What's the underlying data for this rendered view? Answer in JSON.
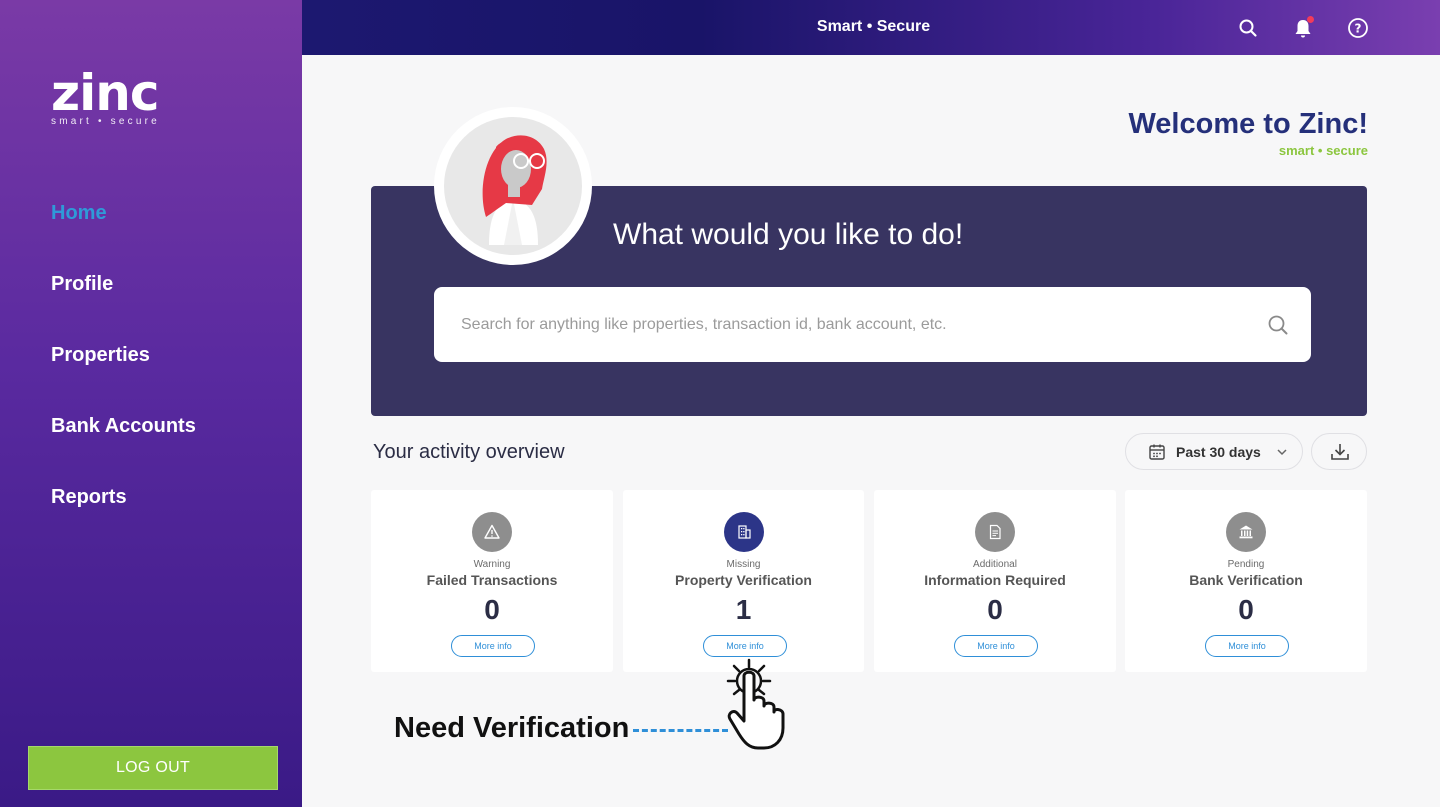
{
  "brand": {
    "logo_text": "zinc",
    "logo_tagline": "smart • secure"
  },
  "sidebar": {
    "items": [
      {
        "label": "Home",
        "active": true
      },
      {
        "label": "Profile"
      },
      {
        "label": "Properties"
      },
      {
        "label": "Bank Accounts"
      },
      {
        "label": "Reports"
      }
    ],
    "logout_label": "LOG OUT"
  },
  "topbar": {
    "title": "Smart • Secure",
    "icons": [
      "search-icon",
      "bell-icon",
      "help-icon"
    ],
    "notification_dot": true
  },
  "welcome": {
    "title": "Welcome to Zinc!",
    "subtitle": "smart • secure"
  },
  "hero": {
    "title": "What would you like to do!",
    "search_placeholder": "Search for anything like properties, transaction id, bank account, etc.",
    "search_value": ""
  },
  "activity": {
    "title": "Your activity overview",
    "range_label": "Past 30 days",
    "cards": [
      {
        "caption": "Warning",
        "title": "Failed Transactions",
        "count": "0",
        "button": "More info",
        "icon": "warning-icon"
      },
      {
        "caption": "Missing",
        "title": "Property Verification",
        "count": "1",
        "button": "More info",
        "icon": "building-icon"
      },
      {
        "caption": "Additional",
        "title": "Information Required",
        "count": "0",
        "button": "More info",
        "icon": "document-icon"
      },
      {
        "caption": "Pending",
        "title": "Bank Verification",
        "count": "0",
        "button": "More info",
        "icon": "bank-icon"
      }
    ]
  },
  "annotation": {
    "text": "Need Verification"
  },
  "colors": {
    "accent": "#2f9ad8",
    "brand_dark": "#25307a",
    "green": "#8cc63f",
    "hero_bg": "#383461",
    "sidebar_top": "#7a3aa6",
    "sidebar_bottom": "#3a1a86"
  }
}
